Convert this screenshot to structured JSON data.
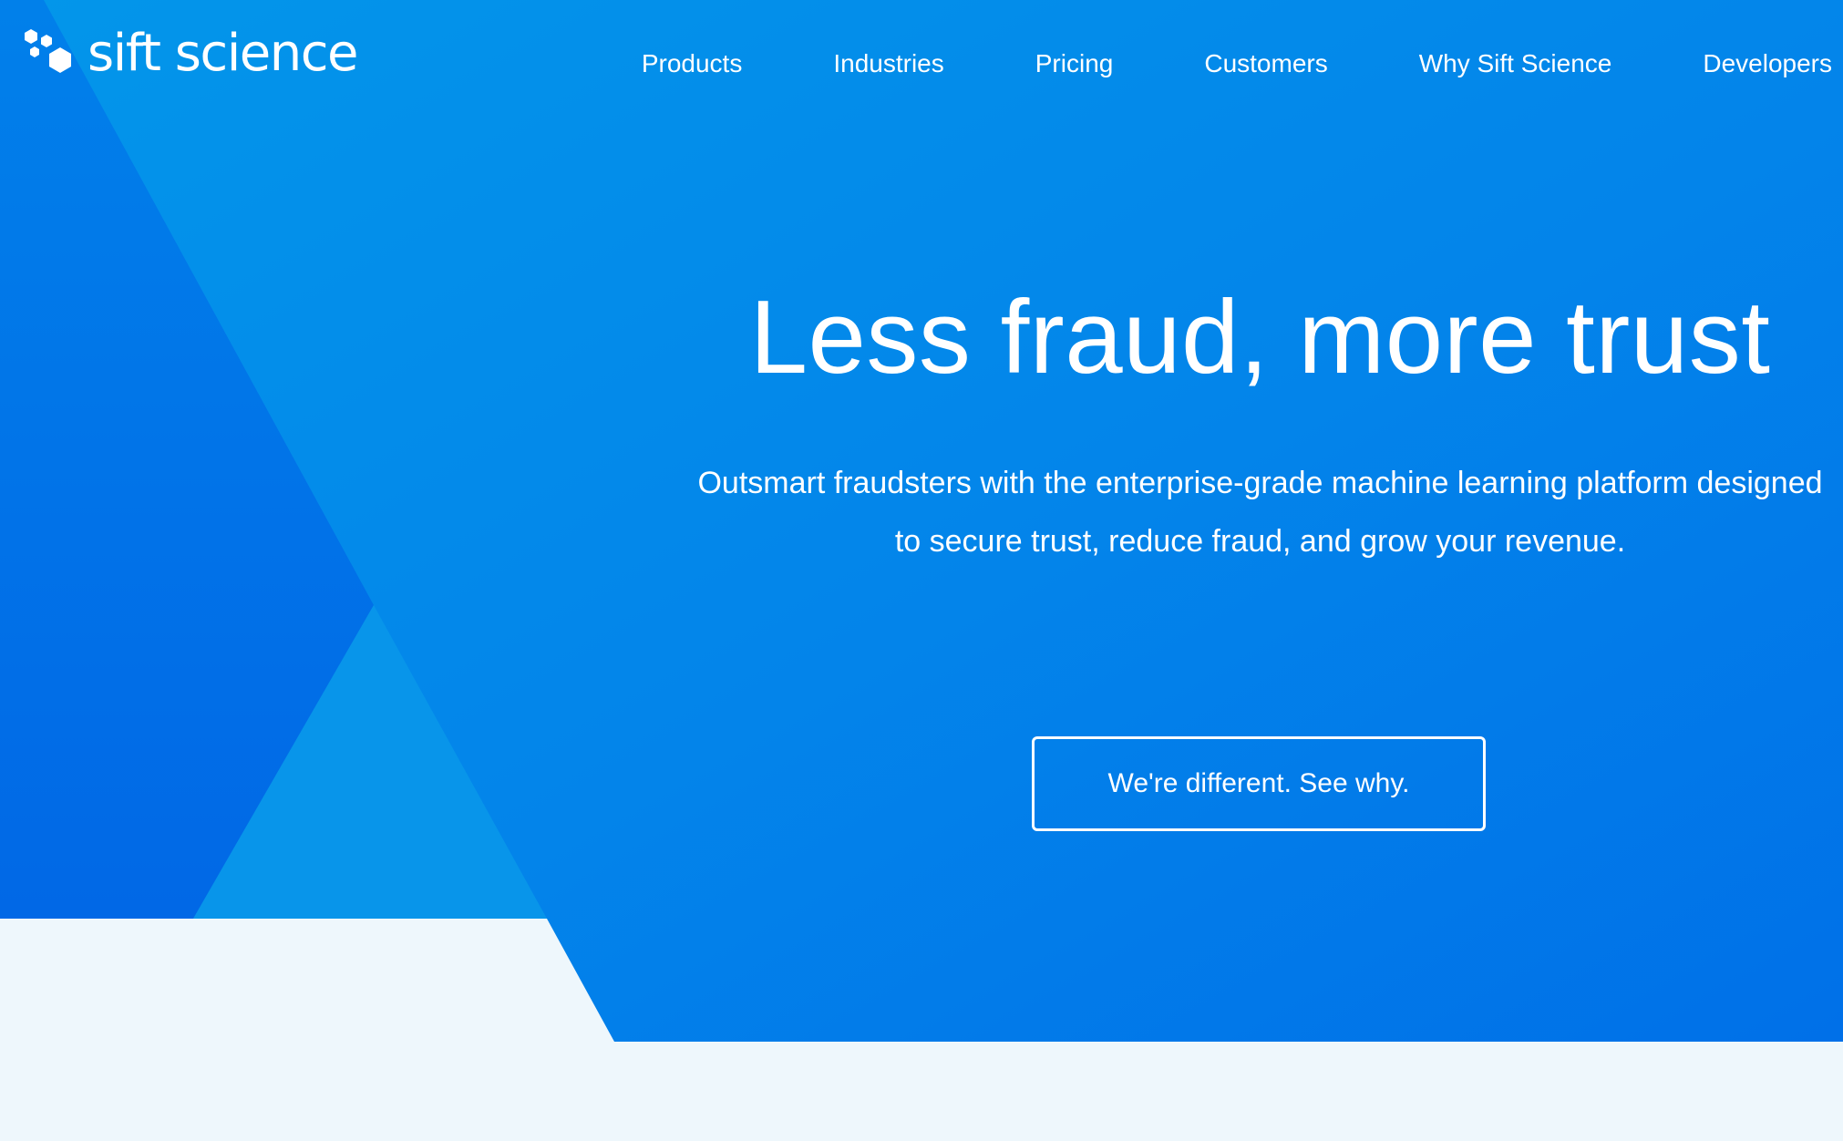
{
  "header": {
    "logo_text": "sift science",
    "logo_icon": "hexagon-cluster-icon",
    "nav": [
      {
        "label": "Products"
      },
      {
        "label": "Industries"
      },
      {
        "label": "Pricing"
      },
      {
        "label": "Customers"
      },
      {
        "label": "Why Sift Science"
      },
      {
        "label": "Developers"
      }
    ]
  },
  "hero": {
    "headline": "Less fraud, more trust",
    "subtext": "Outsmart fraudsters with the enterprise-grade machine learning platform designed to secure trust, reduce fraud, and grow your revenue.",
    "cta_label": "We're different. See why."
  },
  "colors": {
    "hero_blue_light": "#0390ea",
    "hero_blue_dark": "#0070e8",
    "shape_light": "#0895ea",
    "shape_dark": "#0168e6",
    "page_background": "#eef7fc",
    "text": "#ffffff"
  }
}
